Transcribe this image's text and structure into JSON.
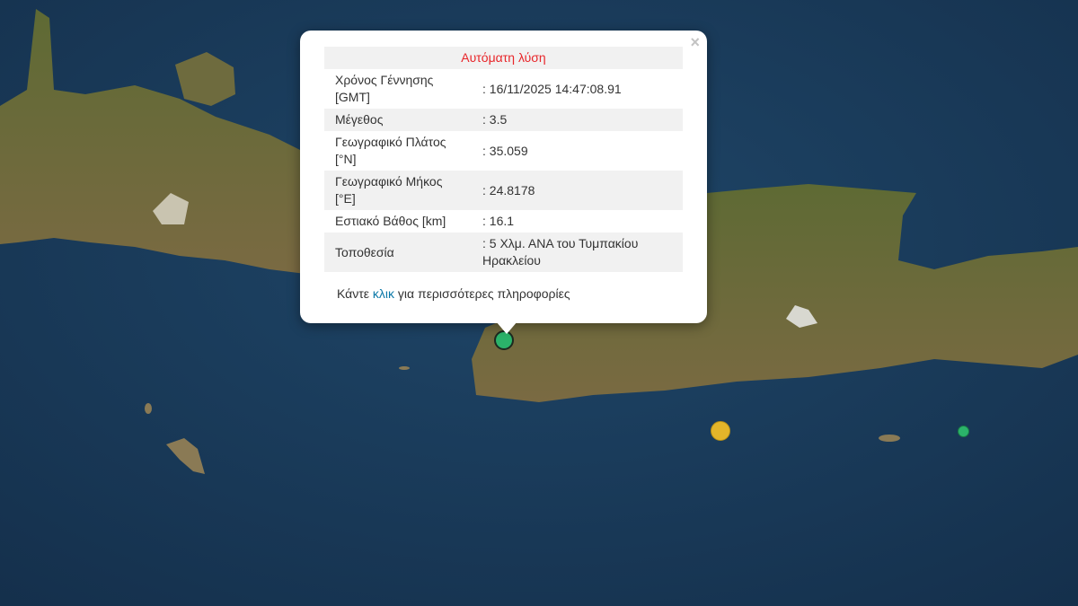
{
  "popup": {
    "title": "Αυτόματη λύση",
    "close_symbol": "×",
    "rows": [
      {
        "label": "Χρόνος Γέννησης [GMT]",
        "value": ": 16/11/2025 14:47:08.91"
      },
      {
        "label": "Μέγεθος",
        "value": ": 3.5"
      },
      {
        "label": "Γεωγραφικό Πλάτος [°N]",
        "value": ": 35.059"
      },
      {
        "label": "Γεωγραφικό Μήκος [°E]",
        "value": ": 24.8178"
      },
      {
        "label": "Εστιακό Βάθος [km]",
        "value": ": 16.1"
      },
      {
        "label": "Τοποθεσία",
        "value": ": 5 Χλμ. ΑΝΑ του Τυμπακίου Ηρακλείου"
      }
    ],
    "more_prefix": "Κάντε ",
    "more_link": "κλικ",
    "more_suffix": " για περισσότερες πληροφορίες",
    "title_color": "#e8262a",
    "link_color": "#0a78a8"
  },
  "markers": [
    {
      "name": "selected-quake",
      "color": "#2bb36a",
      "selected": true
    },
    {
      "name": "quake-yellow",
      "color": "#e3b52a",
      "selected": false
    },
    {
      "name": "quake-green-east",
      "color": "#2bb36a",
      "selected": false
    }
  ],
  "colors": {
    "sea": "#1a3a58",
    "land": "#6b6a3a"
  }
}
